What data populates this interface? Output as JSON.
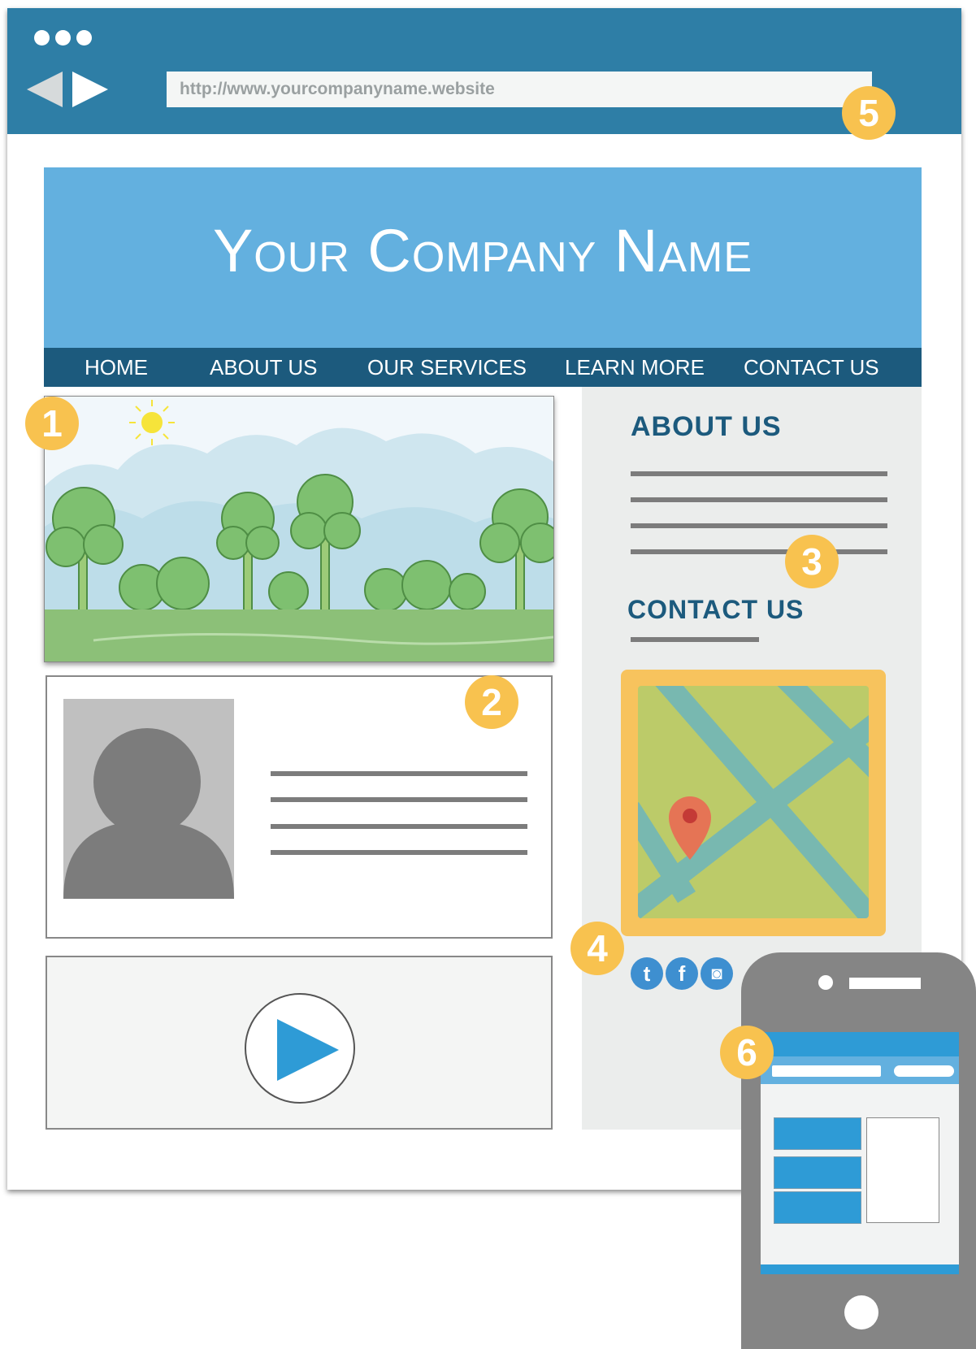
{
  "browser": {
    "address_url": "http://www.yourcompanyname.website"
  },
  "site": {
    "company_name": "Your Company Name",
    "menu": [
      "HOME",
      "ABOUT US",
      "OUR SERVICES",
      "LEARN MORE",
      "CONTACT US"
    ]
  },
  "sidebar": {
    "about_heading": "ABOUT US",
    "contact_heading": "CONTACT US"
  },
  "social_icons": [
    {
      "name": "tumblr-icon",
      "glyph": "t"
    },
    {
      "name": "facebook-icon",
      "glyph": "f"
    },
    {
      "name": "instagram-icon",
      "glyph": "◙"
    }
  ],
  "badges": [
    "1",
    "2",
    "3",
    "4",
    "5",
    "6"
  ],
  "colors": {
    "chrome": "#2e7ea6",
    "header": "#63b0df",
    "menu": "#1c5a7d",
    "badge": "#f8c24f",
    "map_frame": "#f7c35d",
    "phone": "#858585"
  }
}
